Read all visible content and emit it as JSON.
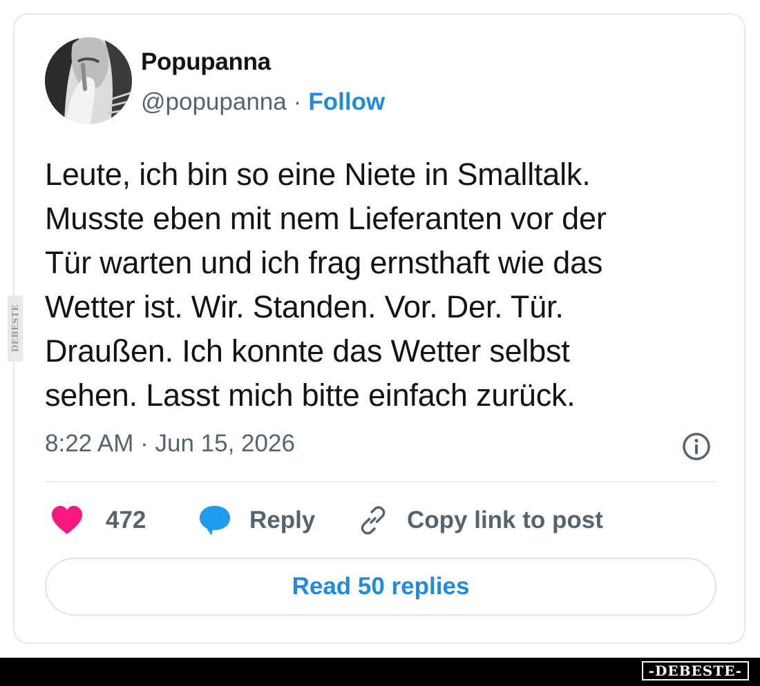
{
  "tweet": {
    "display_name": "Popupanna",
    "handle": "@popupanna",
    "separator": "·",
    "follow_label": "Follow",
    "text_lines": [
      "Leute, ich bin so eine Niete in Smalltalk.",
      "Musste eben mit nem Lieferanten vor der",
      "Tür warten und ich frag ernsthaft wie das",
      "Wetter ist. Wir. Standen. Vor. Der. Tür.",
      "Draußen. Ich konnte das Wetter selbst",
      "sehen. Lasst mich bitte einfach zurück."
    ],
    "timestamp": "8:22 AM · Jun 15, 2026"
  },
  "actions": {
    "like_count": "472",
    "reply_label": "Reply",
    "copy_link_label": "Copy link to post",
    "read_replies_label": "Read 50 replies"
  },
  "icons": {
    "like": "heart-icon",
    "reply": "speech-bubble-icon",
    "copy": "link-icon",
    "info": "info-icon"
  },
  "colors": {
    "accent_blue": "#1d8ce0",
    "like_pink": "#f91880",
    "reply_blue": "#1d9bf0",
    "muted_text": "#536471",
    "border": "#e6e8eb"
  },
  "watermark": {
    "side_text": "DEBESTE",
    "footer_text": "-DEBESTE-"
  }
}
